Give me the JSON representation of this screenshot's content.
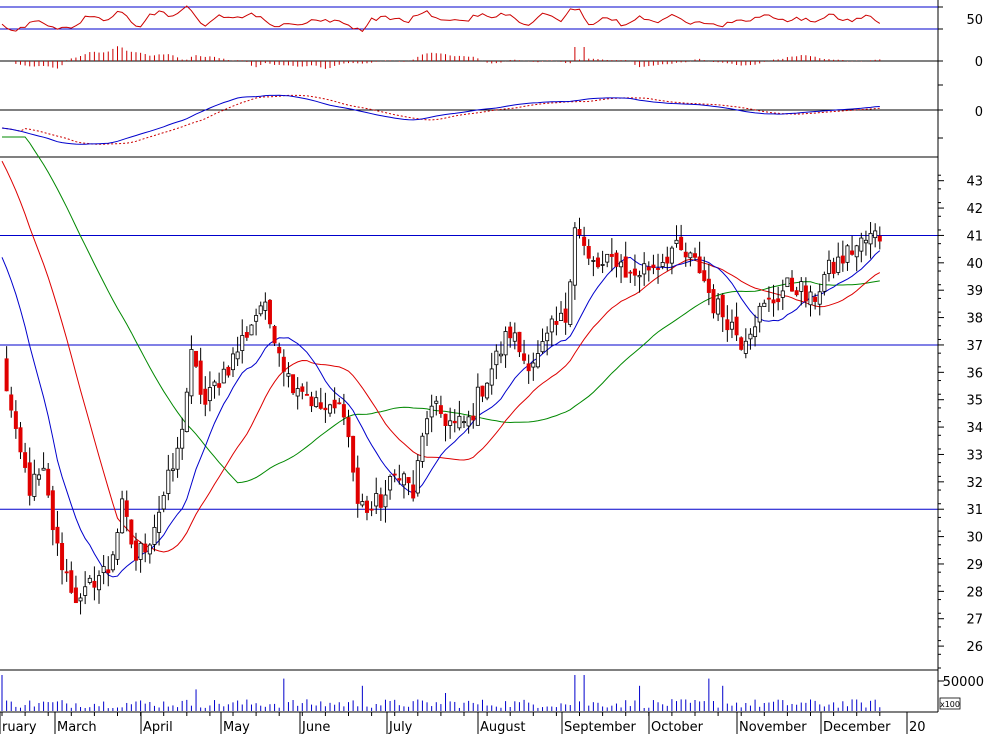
{
  "colors": {
    "background": "#ffffff",
    "grid_line": "#0000cc",
    "separator": "#000000",
    "candle_up": "#ffffff",
    "candle_down": "#e00000",
    "candle_outline": "#000000",
    "ma_short": "#0000cc",
    "ma_mid": "#dd0000",
    "ma_long": "#008800",
    "rsi": "#cc0000",
    "macd_hist": "#cc0000",
    "macd_line": "#0000cc",
    "macd_signal": "#cc0000",
    "volume": "#0000cc"
  },
  "chart_data": {
    "type": "candlestick",
    "months": [
      "ruary",
      "March",
      "April",
      "May",
      "June",
      "July",
      "August",
      "September",
      "October",
      "November",
      "December",
      "20"
    ],
    "price_axis": {
      "ylim": [
        25.2,
        43.5
      ],
      "ticks": [
        "43",
        "42",
        "41",
        "40",
        "39",
        "38",
        "37",
        "36",
        "35",
        "34",
        "33",
        "32",
        "31",
        "30",
        "29",
        "28",
        "27",
        "26"
      ],
      "reference_lines": [
        41.0,
        37.0,
        31.0
      ]
    },
    "volume_axis": {
      "tick": "50000",
      "unit_label": "x100"
    },
    "rsi_axis": {
      "tick": "50",
      "lines": [
        70,
        50
      ]
    },
    "hist_axis": {
      "tick": "0"
    },
    "macd_axis": {
      "tick": "0"
    },
    "price_anchors": [
      [
        0,
        36.5
      ],
      [
        3,
        33.5
      ],
      [
        6,
        31.8
      ],
      [
        9,
        32.2
      ],
      [
        12,
        29.5
      ],
      [
        15,
        28.2
      ],
      [
        17,
        27.5
      ],
      [
        20,
        28.5
      ],
      [
        23,
        28.8
      ],
      [
        26,
        31.0
      ],
      [
        29,
        29.2
      ],
      [
        32,
        30.0
      ],
      [
        35,
        31.5
      ],
      [
        38,
        33.0
      ],
      [
        41,
        36.5
      ],
      [
        44,
        34.8
      ],
      [
        47,
        35.8
      ],
      [
        50,
        36.5
      ],
      [
        53,
        37.5
      ],
      [
        56,
        38.5
      ],
      [
        59,
        37.5
      ],
      [
        62,
        35.8
      ],
      [
        65,
        35.5
      ],
      [
        68,
        34.8
      ],
      [
        71,
        34.5
      ],
      [
        74,
        34.8
      ],
      [
        77,
        31.2
      ],
      [
        80,
        31.0
      ],
      [
        83,
        31.5
      ],
      [
        86,
        32.5
      ],
      [
        89,
        31.5
      ],
      [
        92,
        34.5
      ],
      [
        95,
        34.5
      ],
      [
        98,
        34.0
      ],
      [
        101,
        34.2
      ],
      [
        104,
        35.5
      ],
      [
        107,
        36.5
      ],
      [
        110,
        37.5
      ],
      [
        113,
        36.5
      ],
      [
        116,
        36.5
      ],
      [
        119,
        37.5
      ],
      [
        122,
        38.0
      ],
      [
        124,
        41.5
      ],
      [
        127,
        40.0
      ],
      [
        130,
        39.8
      ],
      [
        133,
        40.2
      ],
      [
        136,
        39.5
      ],
      [
        139,
        39.8
      ],
      [
        142,
        40.0
      ],
      [
        145,
        40.5
      ],
      [
        148,
        40.2
      ],
      [
        151,
        39.8
      ],
      [
        154,
        38.5
      ],
      [
        157,
        38.0
      ],
      [
        160,
        37.2
      ],
      [
        163,
        38.0
      ],
      [
        166,
        38.5
      ],
      [
        169,
        39.0
      ],
      [
        172,
        39.2
      ],
      [
        175,
        38.5
      ],
      [
        178,
        39.5
      ],
      [
        181,
        40.0
      ],
      [
        184,
        40.5
      ],
      [
        187,
        40.8
      ],
      [
        189,
        41.0
      ]
    ],
    "volume_spikes": [
      [
        0,
        1.0
      ],
      [
        124,
        1.0
      ],
      [
        126,
        1.0
      ],
      [
        138,
        0.7
      ],
      [
        153,
        0.9
      ],
      [
        156,
        0.7
      ],
      [
        61,
        0.9
      ],
      [
        42,
        0.6
      ],
      [
        78,
        0.7
      ],
      [
        96,
        0.5
      ]
    ]
  }
}
